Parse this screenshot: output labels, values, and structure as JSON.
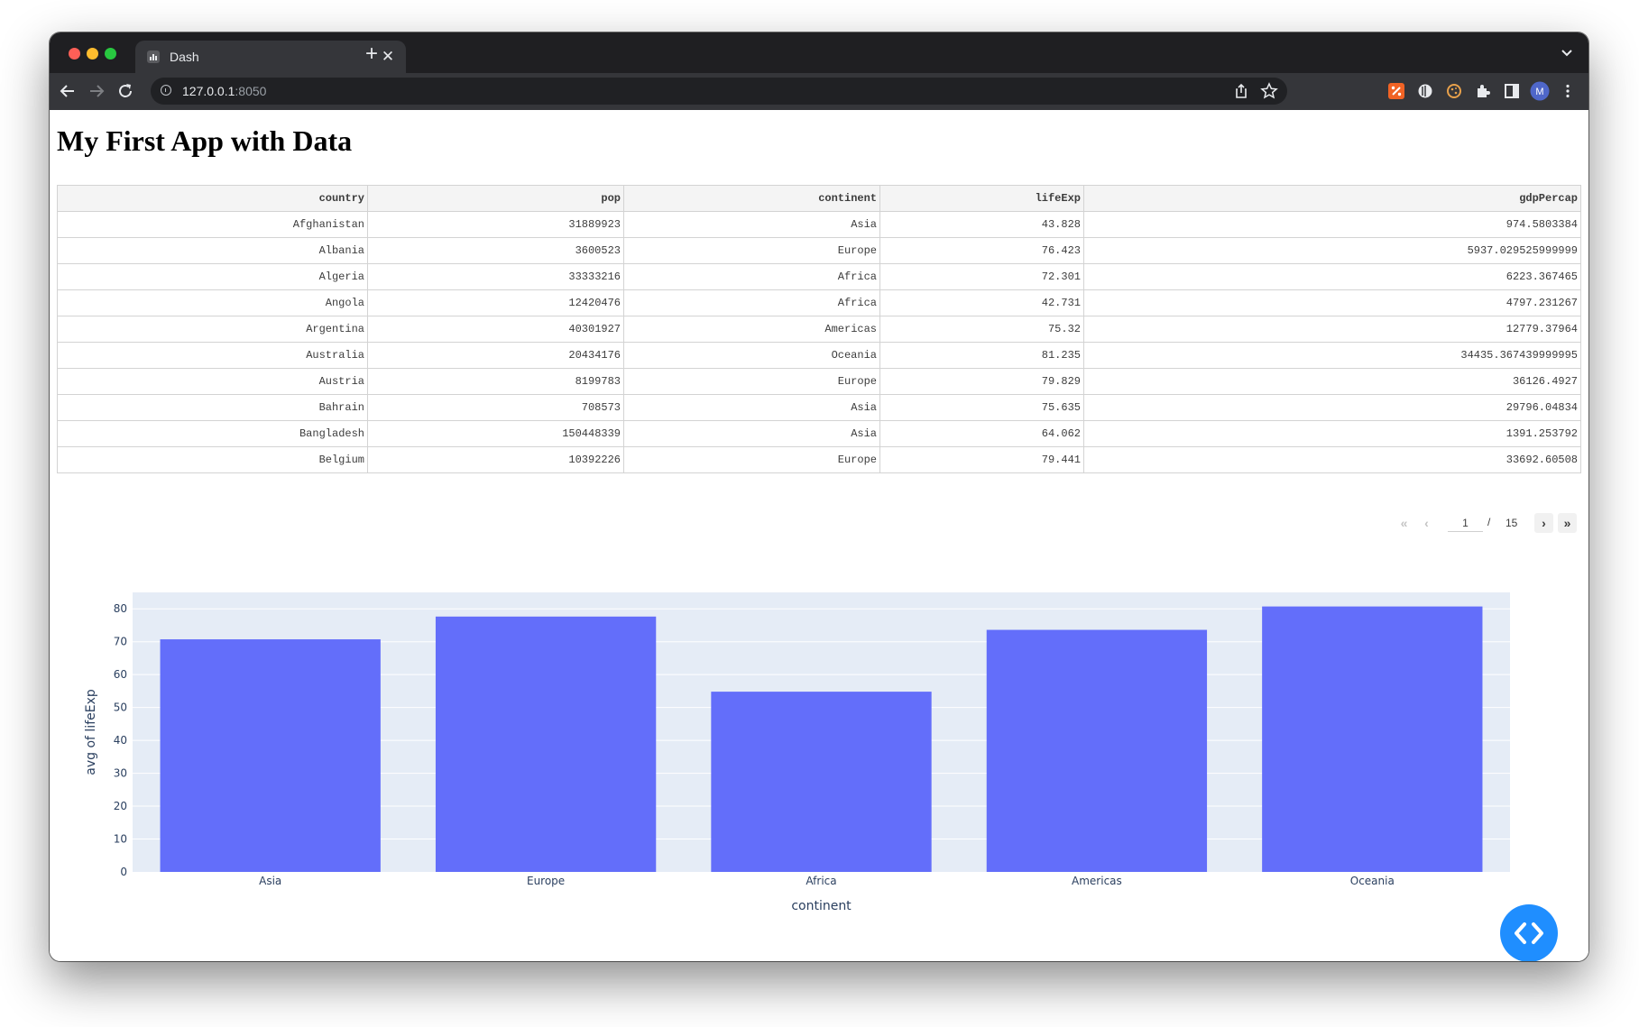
{
  "browser": {
    "tab_title": "Dash",
    "url_host": "127.0.0.1",
    "url_port": ":8050"
  },
  "page": {
    "title": "My First App with Data"
  },
  "table": {
    "columns": [
      "country",
      "pop",
      "continent",
      "lifeExp",
      "gdpPercap"
    ],
    "rows": [
      [
        "Afghanistan",
        "31889923",
        "Asia",
        "43.828",
        "974.5803384"
      ],
      [
        "Albania",
        "3600523",
        "Europe",
        "76.423",
        "5937.029525999999"
      ],
      [
        "Algeria",
        "33333216",
        "Africa",
        "72.301",
        "6223.367465"
      ],
      [
        "Angola",
        "12420476",
        "Africa",
        "42.731",
        "4797.231267"
      ],
      [
        "Argentina",
        "40301927",
        "Americas",
        "75.32",
        "12779.37964"
      ],
      [
        "Australia",
        "20434176",
        "Oceania",
        "81.235",
        "34435.367439999995"
      ],
      [
        "Austria",
        "8199783",
        "Europe",
        "79.829",
        "36126.4927"
      ],
      [
        "Bahrain",
        "708573",
        "Asia",
        "75.635",
        "29796.04834"
      ],
      [
        "Bangladesh",
        "150448339",
        "Asia",
        "64.062",
        "1391.253792"
      ],
      [
        "Belgium",
        "10392226",
        "Europe",
        "79.441",
        "33692.60508"
      ]
    ]
  },
  "pagination": {
    "current_page": "1",
    "separator": "/",
    "total_pages": "15"
  },
  "chart_data": {
    "type": "bar",
    "categories": [
      "Asia",
      "Europe",
      "Africa",
      "Americas",
      "Oceania"
    ],
    "values": [
      70.73,
      77.65,
      54.81,
      73.61,
      80.72
    ],
    "title": "",
    "xlabel": "continent",
    "ylabel": "avg of lifeExp",
    "ylim": [
      0,
      85
    ],
    "yticks": [
      0,
      10,
      20,
      30,
      40,
      50,
      60,
      70,
      80
    ],
    "grid": true,
    "colors": {
      "bar": "#636efa",
      "plot_bg": "#e5ecf6",
      "grid": "#ffffff",
      "text": "#2a3f5f"
    }
  },
  "colors": {
    "fab": "#1f8eff"
  }
}
